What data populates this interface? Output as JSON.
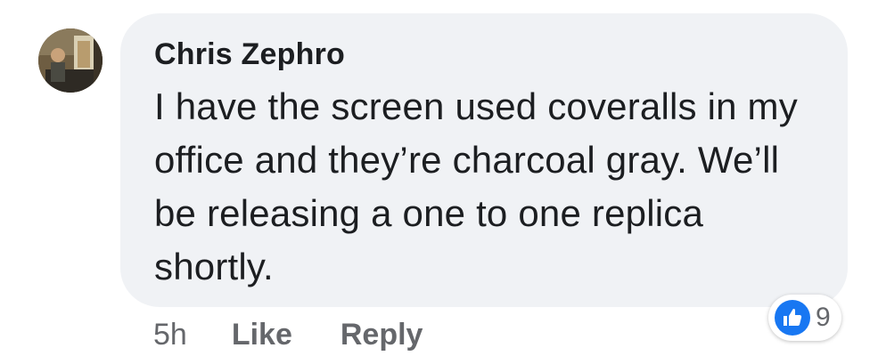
{
  "comment": {
    "author": "Chris Zephro",
    "text": "I have the screen used coveralls in my office and they’re charcoal gray. We’ll be releasing a one to one replica shortly.",
    "timestamp": "5h",
    "like_label": "Like",
    "reply_label": "Reply",
    "reaction_count": "9",
    "reaction_icon": "thumbs-up-icon",
    "colors": {
      "bubble": "#f0f2f5",
      "text": "#1c1e21",
      "meta": "#65676b",
      "like_badge": "#1877f2"
    }
  }
}
